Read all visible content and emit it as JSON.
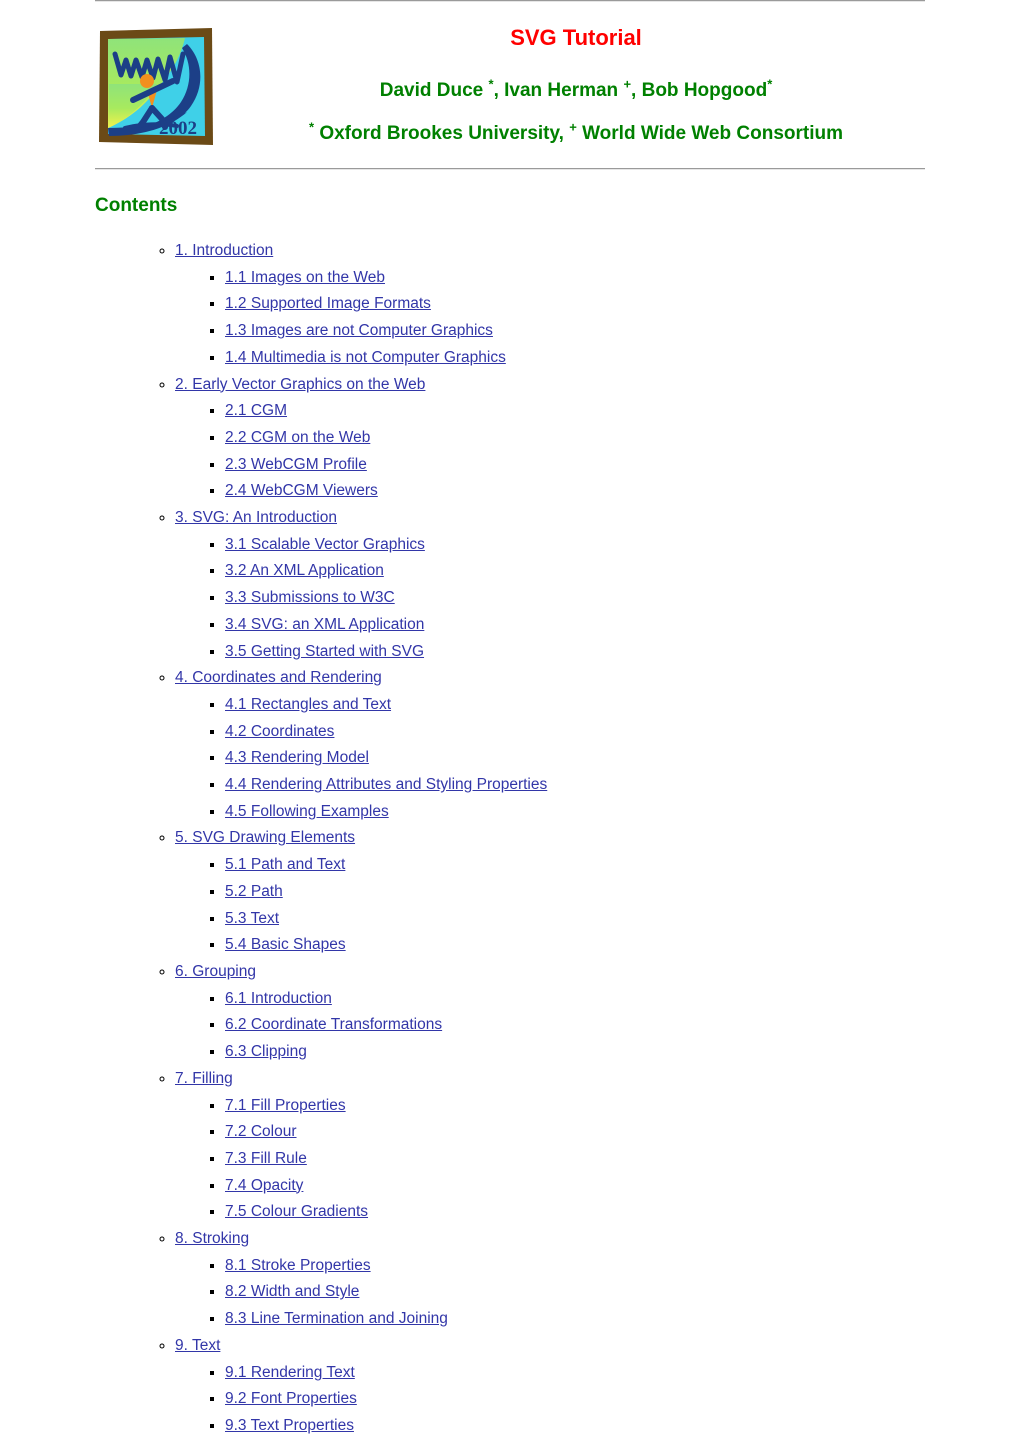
{
  "document": {
    "title": "SVG Tutorial",
    "title_color": "#ff0000",
    "heading_color": "#008000",
    "link_color": "#3236a8",
    "background_color": "#ffffff"
  },
  "logo": {
    "name": "www2002-conference-logo",
    "alt": "WWW 2002",
    "year_text": "2002",
    "wordmark_text": "WWW",
    "colors": {
      "frame": "#6b4a16",
      "sky": "#3fd0e8",
      "land_top": "#7fe06a",
      "land_bottom": "#f2f24a",
      "wave": "#1c3f87",
      "figure": "#f2901e"
    }
  },
  "authors": {
    "line": [
      {
        "text": "David Duce ",
        "sup": "*"
      },
      {
        "text": ", Ivan Herman ",
        "sup": "+"
      },
      {
        "text": ", Bob Hopgood",
        "sup": "*"
      }
    ],
    "plain": "David Duce *, Ivan Herman +, Bob Hopgood *"
  },
  "affiliations": {
    "sup_oxford": "*",
    "oxford": " Oxford Brookes University, ",
    "sup_w3c": "+",
    "w3c": " World Wide Web Consortium",
    "plain": "* Oxford Brookes University, + World Wide Web Consortium"
  },
  "contents": {
    "heading": "Contents",
    "sections": [
      {
        "label": "1. Introduction",
        "items": [
          "1.1 Images on the Web",
          "1.2 Supported Image Formats",
          "1.3 Images are not Computer Graphics",
          "1.4 Multimedia is not Computer Graphics"
        ]
      },
      {
        "label": "2. Early Vector Graphics on the Web",
        "items": [
          "2.1 CGM",
          "2.2 CGM on the Web",
          "2.3 WebCGM Profile",
          "2.4 WebCGM Viewers"
        ]
      },
      {
        "label": "3. SVG: An Introduction",
        "items": [
          "3.1 Scalable Vector Graphics",
          "3.2 An XML Application",
          "3.3 Submissions to W3C",
          "3.4 SVG: an XML Application",
          "3.5 Getting Started with SVG"
        ]
      },
      {
        "label": "4. Coordinates and Rendering",
        "items": [
          "4.1 Rectangles and Text",
          "4.2 Coordinates",
          "4.3 Rendering Model",
          "4.4 Rendering Attributes and Styling Properties",
          "4.5 Following Examples"
        ]
      },
      {
        "label": "5. SVG Drawing Elements",
        "items": [
          "5.1 Path and Text",
          "5.2 Path",
          "5.3 Text",
          "5.4 Basic Shapes"
        ]
      },
      {
        "label": "6. Grouping",
        "items": [
          "6.1 Introduction",
          "6.2 Coordinate Transformations",
          "6.3 Clipping"
        ]
      },
      {
        "label": "7. Filling",
        "items": [
          "7.1 Fill Properties",
          "7.2 Colour",
          "7.3 Fill Rule",
          "7.4 Opacity",
          "7.5 Colour Gradients"
        ]
      },
      {
        "label": "8. Stroking",
        "items": [
          "8.1 Stroke Properties",
          "8.2 Width and Style",
          "8.3 Line Termination and Joining"
        ]
      },
      {
        "label": "9. Text",
        "items": [
          "9.1 Rendering Text",
          "9.2 Font Properties",
          "9.3 Text Properties"
        ]
      }
    ]
  }
}
